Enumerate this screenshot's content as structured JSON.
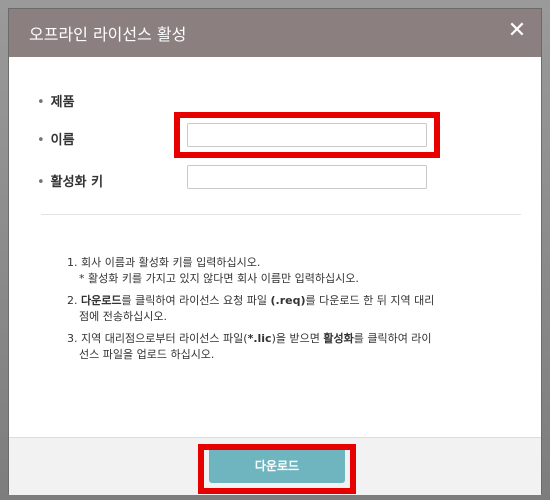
{
  "dialog": {
    "title": "오프라인 라이선스 활성",
    "close_label": "✕"
  },
  "form": {
    "bullet": "•",
    "product_label": "제품",
    "name_label": "이름",
    "name_value": "",
    "activation_key_label": "활성화 키",
    "activation_key_value": ""
  },
  "instructions": {
    "step1_line1": "1. 회사 이름과 활성화 키를 입력하십시오.",
    "step1_line2": "* 활성화 키를 가지고 있지 않다면 회사 이름만 입력하십시오.",
    "step2_num": "2. ",
    "step2_bold1": "다운로드",
    "step2_mid": "를 클릭하여 라이선스 요청 파일 ",
    "step2_bold2": "(.req)",
    "step2_end": "를 다운로드 한 뒤 지역 대리",
    "step2_line2": "점에 전송하십시오.",
    "step3_line1a": "3. 지역 대리점으로부터 라이선스 파일(",
    "step3_bold1": "*.lic",
    "step3_line1b": ")을 받으면 ",
    "step3_bold2": "활성화",
    "step3_line1c": "를 클릭하여 라이",
    "step3_line2": "선스 파일을 업로드 하십시오."
  },
  "footer": {
    "download_label": "다운로드"
  },
  "colors": {
    "titlebar": "#8c7f7f",
    "highlight": "#e60000",
    "button": "#6fb5bf"
  }
}
